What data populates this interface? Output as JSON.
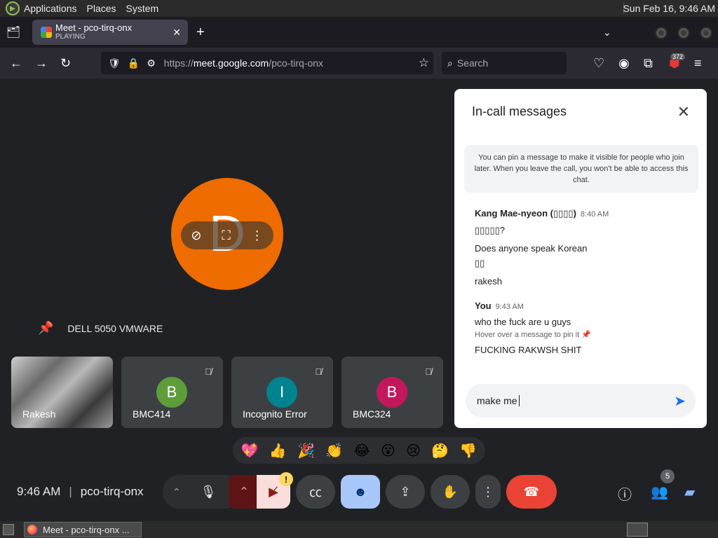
{
  "system_panel": {
    "menus": [
      "Applications",
      "Places",
      "System"
    ],
    "clock": "Sun Feb 16,  9:46 AM"
  },
  "browser": {
    "tab": {
      "title": "Meet - pco-tirq-onx",
      "subtitle": "PLAYING"
    },
    "url_prefix": "https://",
    "url_host": "meet.google.com",
    "url_path": "/pco-tirq-onx",
    "search_placeholder": "Search",
    "extension_badge": "372"
  },
  "meet": {
    "main_tile": {
      "initial": "D",
      "name": "DELL 5050 VMWARE",
      "avatar_color": "#ef6c00"
    },
    "participants": [
      {
        "name": "Rakesh",
        "initial": "",
        "color": "",
        "camera": true
      },
      {
        "name": "BMC414",
        "initial": "B",
        "color": "#5e9e3a"
      },
      {
        "name": "Incognito Error",
        "initial": "I",
        "color": "#00838f"
      },
      {
        "name": "BMC324",
        "initial": "B",
        "color": "#c2185b"
      }
    ],
    "reactions": [
      "💖",
      "👍",
      "🎉",
      "👏",
      "😂",
      "😮",
      "😢",
      "🤔",
      "👎"
    ],
    "time": "9:46 AM",
    "meeting_code": "pco-tirq-onx",
    "people_count": "5",
    "camera_warning": "!"
  },
  "chat": {
    "title": "In-call messages",
    "notice": "You can pin a message to make it visible for people who join later. When you leave the call, you won't be able to access this chat.",
    "groups": [
      {
        "sender": "Kang Mae-nyeon (▯▯▯▯)",
        "time": "8:40 AM",
        "messages": [
          "▯▯▯▯▯?",
          "Does anyone speak Korean",
          "▯▯",
          "rakesh"
        ]
      },
      {
        "sender": "You",
        "time": "9:43 AM",
        "messages": [
          "who the fuck are u guys",
          "FUCKING RAKWSH SHIT"
        ],
        "hint": "Hover over a message to pin it 📌"
      }
    ],
    "input_value": "make me"
  }
}
